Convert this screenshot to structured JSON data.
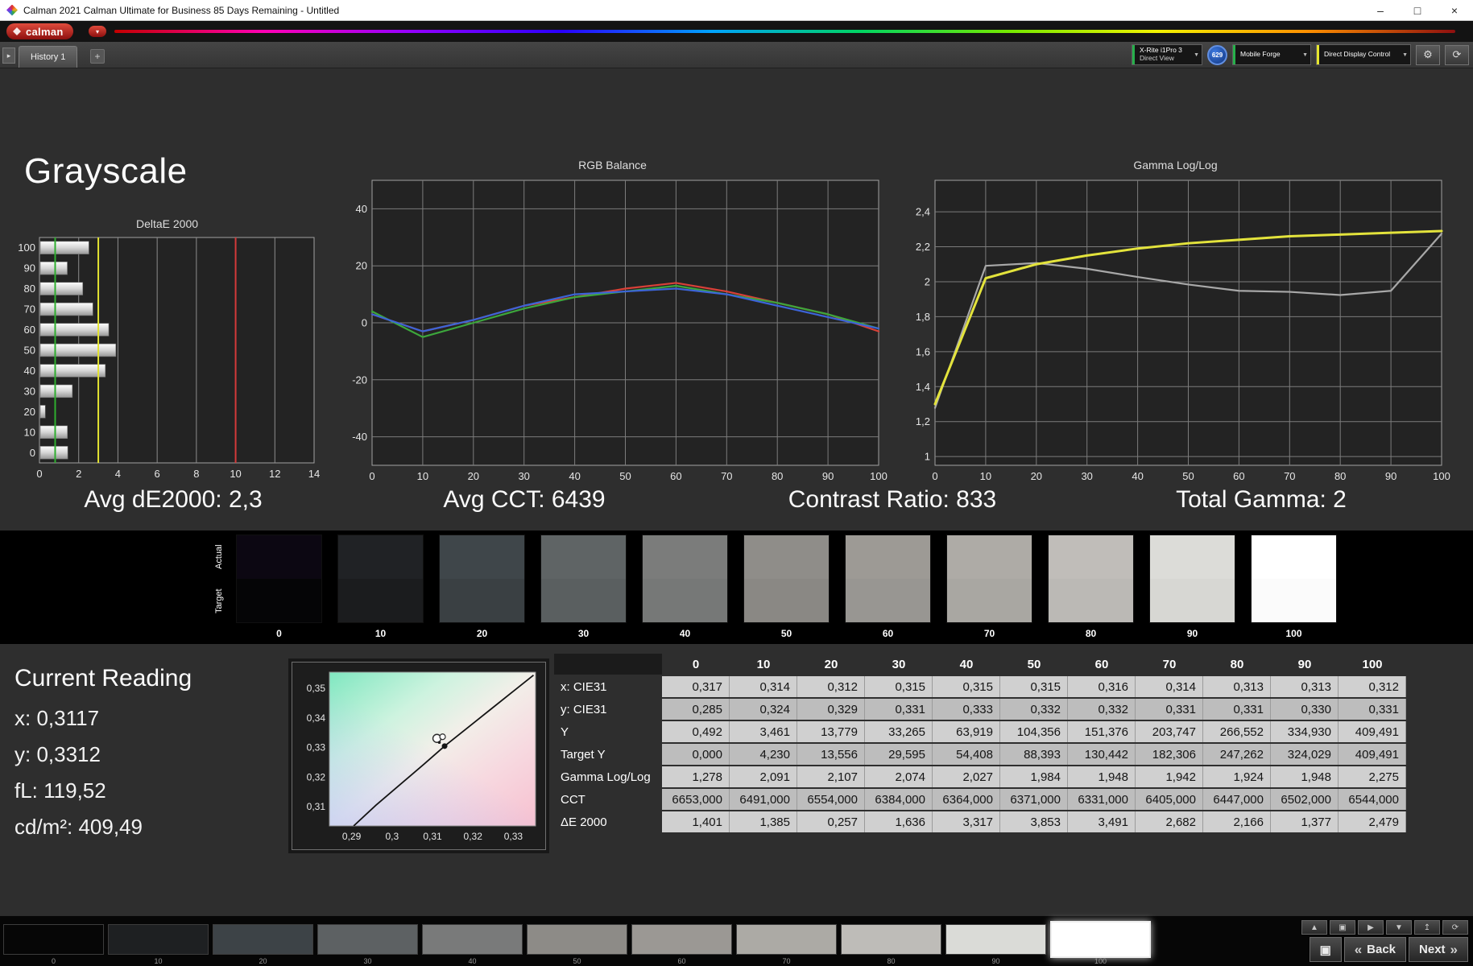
{
  "window": {
    "title": "Calman 2021 Calman Ultimate for Business 85 Days Remaining  - Untitled",
    "minimize": "–",
    "maximize": "□",
    "close": "×"
  },
  "brand": {
    "logo_text": "calman",
    "caret": "▾"
  },
  "tabbar": {
    "scroll_icon": "▸",
    "tab": "History 1",
    "add_icon": "+",
    "meter_line1": "X-Rite i1Pro 3",
    "meter_line2": "Direct View",
    "badge": "629",
    "source": "Mobile Forge",
    "display": "Direct Display Control",
    "combo_caret": "▼",
    "gear_icon": "⚙",
    "refresh_icon": "⟳"
  },
  "page": {
    "title": "Grayscale"
  },
  "summary": {
    "avg_de": "Avg dE2000: 2,3",
    "avg_cct": "Avg CCT: 6439",
    "contrast": "Contrast Ratio: 833",
    "total_gamma": "Total Gamma: 2"
  },
  "chart_data": [
    {
      "type": "bar",
      "orientation": "horizontal",
      "title": "DeltaE 2000",
      "categories": [
        "100",
        "90",
        "80",
        "70",
        "60",
        "50",
        "40",
        "30",
        "20",
        "10",
        "0"
      ],
      "values": [
        2.479,
        1.377,
        2.166,
        2.682,
        3.491,
        3.853,
        3.317,
        1.636,
        0.257,
        1.385,
        1.401
      ],
      "xlim": [
        0,
        14
      ],
      "xticks": [
        0,
        2,
        4,
        6,
        8,
        10,
        12,
        14
      ],
      "ref_lines": [
        {
          "name": "good",
          "value": 0.8,
          "color": "#2fae2f"
        },
        {
          "name": "warning",
          "value": 3,
          "color": "#e4e432"
        },
        {
          "name": "fail",
          "value": 10,
          "color": "#d43a3a"
        }
      ],
      "grid": true,
      "legend": "none"
    },
    {
      "type": "line",
      "title": "RGB Balance",
      "x": [
        0,
        10,
        20,
        30,
        40,
        50,
        60,
        70,
        80,
        90,
        100
      ],
      "ylim": [
        -50,
        50
      ],
      "yticks": [
        40,
        20,
        0,
        -20,
        -40
      ],
      "ytick_labels": [
        "40",
        "20",
        "0",
        "-20",
        "-40"
      ],
      "series": [
        {
          "name": "Red",
          "color": "#d84038",
          "values": [
            3,
            -3,
            1,
            6,
            9,
            12,
            14,
            11,
            7,
            3,
            -3
          ]
        },
        {
          "name": "Green",
          "color": "#3ca63c",
          "values": [
            4,
            -5,
            0,
            5,
            9,
            11,
            13,
            10,
            7,
            3,
            -2
          ]
        },
        {
          "name": "Blue",
          "color": "#3c64d8",
          "values": [
            3,
            -3,
            1,
            6,
            10,
            11,
            12,
            10,
            6,
            2,
            -2
          ]
        }
      ],
      "grid": true,
      "legend": "none"
    },
    {
      "type": "line",
      "title": "Gamma Log/Log",
      "x": [
        0,
        10,
        20,
        30,
        40,
        50,
        60,
        70,
        80,
        90,
        100
      ],
      "ylim": [
        0.95,
        2.58
      ],
      "yticks": [
        2.4,
        2.2,
        2,
        1.8,
        1.6,
        1.4,
        1.2,
        1
      ],
      "ytick_labels": [
        "2,4",
        "2,2",
        "2",
        "1,8",
        "1,6",
        "1,4",
        "1,2",
        "1"
      ],
      "series": [
        {
          "name": "Measured Gamma",
          "color": "#a8a8a8",
          "width": 2.2,
          "values": [
            1.278,
            2.091,
            2.107,
            2.074,
            2.027,
            1.984,
            1.948,
            1.942,
            1.924,
            1.948,
            2.275
          ]
        },
        {
          "name": "Target Gamma",
          "color": "#e3e33c",
          "width": 3,
          "values": [
            1.3,
            2.02,
            2.1,
            2.15,
            2.19,
            2.22,
            2.24,
            2.26,
            2.27,
            2.28,
            2.29
          ]
        }
      ],
      "grid": true,
      "legend": "none"
    },
    {
      "type": "scatter",
      "xlim": [
        0.2845,
        0.3355
      ],
      "ylim": [
        0.3035,
        0.3555
      ],
      "xticks": [
        0.29,
        0.3,
        0.31,
        0.32,
        0.33
      ],
      "xtick_labels": [
        "0,29",
        "0,3",
        "0,31",
        "0,32",
        "0,33"
      ],
      "yticks": [
        0.35,
        0.34,
        0.33,
        0.32,
        0.31
      ],
      "ytick_labels": [
        "0,35",
        "0,34",
        "0,33",
        "0,32",
        "0,31"
      ],
      "locus": [
        [
          0.2905,
          0.3035
        ],
        [
          0.296,
          0.3105
        ],
        [
          0.302,
          0.3175
        ],
        [
          0.308,
          0.3245
        ],
        [
          0.313,
          0.3305
        ],
        [
          0.3185,
          0.3365
        ],
        [
          0.324,
          0.3425
        ],
        [
          0.3295,
          0.3485
        ],
        [
          0.335,
          0.3545
        ]
      ],
      "reference_point": [
        0.313,
        0.3305
      ],
      "measured_point": [
        0.3117,
        0.3312
      ],
      "grid": false,
      "legend": "none"
    }
  ],
  "strip": {
    "actual_label": "Actual",
    "target_label": "Target",
    "levels": [
      {
        "label": "0",
        "actual": "#0c0712",
        "target": "#050506"
      },
      {
        "label": "10",
        "actual": "#202225",
        "target": "#1b1c1e"
      },
      {
        "label": "20",
        "actual": "#3f464a",
        "target": "#3a4043"
      },
      {
        "label": "30",
        "actual": "#5f6465",
        "target": "#5a5f60"
      },
      {
        "label": "40",
        "actual": "#7b7c7b",
        "target": "#767877"
      },
      {
        "label": "50",
        "actual": "#8f8d89",
        "target": "#8a8884"
      },
      {
        "label": "60",
        "actual": "#9d9a95",
        "target": "#989692"
      },
      {
        "label": "70",
        "actual": "#aeaba6",
        "target": "#a9a7a2"
      },
      {
        "label": "80",
        "actual": "#c0bdb9",
        "target": "#bbb9b5"
      },
      {
        "label": "90",
        "actual": "#dcdcd8",
        "target": "#d7d7d3"
      },
      {
        "label": "100",
        "actual": "#ffffff",
        "target": "#fbfbfb"
      }
    ]
  },
  "reading": {
    "title": "Current Reading",
    "x": "x: 0,3117",
    "y": "y: 0,3312",
    "fl": "fL: 119,52",
    "cd": "cd/m²: 409,49"
  },
  "table": {
    "columns": [
      "0",
      "10",
      "20",
      "30",
      "40",
      "50",
      "60",
      "70",
      "80",
      "90",
      "100"
    ],
    "rows": [
      {
        "label": "x: CIE31",
        "values": [
          "0,317",
          "0,314",
          "0,312",
          "0,315",
          "0,315",
          "0,315",
          "0,316",
          "0,314",
          "0,313",
          "0,313",
          "0,312"
        ]
      },
      {
        "label": "y: CIE31",
        "values": [
          "0,285",
          "0,324",
          "0,329",
          "0,331",
          "0,333",
          "0,332",
          "0,332",
          "0,331",
          "0,331",
          "0,330",
          "0,331"
        ]
      },
      {
        "label": "Y",
        "values": [
          "0,492",
          "3,461",
          "13,779",
          "33,265",
          "63,919",
          "104,356",
          "151,376",
          "203,747",
          "266,552",
          "334,930",
          "409,491"
        ]
      },
      {
        "label": "Target Y",
        "values": [
          "0,000",
          "4,230",
          "13,556",
          "29,595",
          "54,408",
          "88,393",
          "130,442",
          "182,306",
          "247,262",
          "324,029",
          "409,491"
        ]
      },
      {
        "label": "Gamma Log/Log",
        "values": [
          "1,278",
          "2,091",
          "2,107",
          "2,074",
          "2,027",
          "1,984",
          "1,948",
          "1,942",
          "1,924",
          "1,948",
          "2,275"
        ]
      },
      {
        "label": "CCT",
        "values": [
          "6653,000",
          "6491,000",
          "6554,000",
          "6384,000",
          "6364,000",
          "6371,000",
          "6331,000",
          "6405,000",
          "6447,000",
          "6502,000",
          "6544,000"
        ]
      },
      {
        "label": "ΔE 2000",
        "values": [
          "1,401",
          "1,385",
          "0,257",
          "1,636",
          "3,317",
          "3,853",
          "3,491",
          "2,682",
          "2,166",
          "1,377",
          "2,479"
        ]
      }
    ]
  },
  "bottom": {
    "swatches": [
      {
        "label": "0",
        "color": "#060606",
        "selected": false
      },
      {
        "label": "10",
        "color": "#1e2022",
        "selected": false
      },
      {
        "label": "20",
        "color": "#3d4347",
        "selected": false
      },
      {
        "label": "30",
        "color": "#5d6163",
        "selected": false
      },
      {
        "label": "40",
        "color": "#797a7a",
        "selected": false
      },
      {
        "label": "50",
        "color": "#8d8b87",
        "selected": false
      },
      {
        "label": "60",
        "color": "#9b9894",
        "selected": false
      },
      {
        "label": "70",
        "color": "#acaaa5",
        "selected": false
      },
      {
        "label": "80",
        "color": "#bebcb8",
        "selected": false
      },
      {
        "label": "90",
        "color": "#dadbd7",
        "selected": false
      },
      {
        "label": "100",
        "color": "#ffffff",
        "selected": true
      }
    ],
    "small_buttons": [
      {
        "name": "collapse",
        "icon": "▲"
      },
      {
        "name": "monitor",
        "icon": "▣"
      },
      {
        "name": "play",
        "icon": "▶"
      },
      {
        "name": "save",
        "icon": "▼"
      },
      {
        "name": "eject",
        "icon": "↥"
      },
      {
        "name": "refresh",
        "icon": "⟳"
      }
    ],
    "display_icon": "▣",
    "back_label": "Back",
    "next_label": "Next",
    "back_chevrons": "«",
    "next_chevrons": "»"
  }
}
